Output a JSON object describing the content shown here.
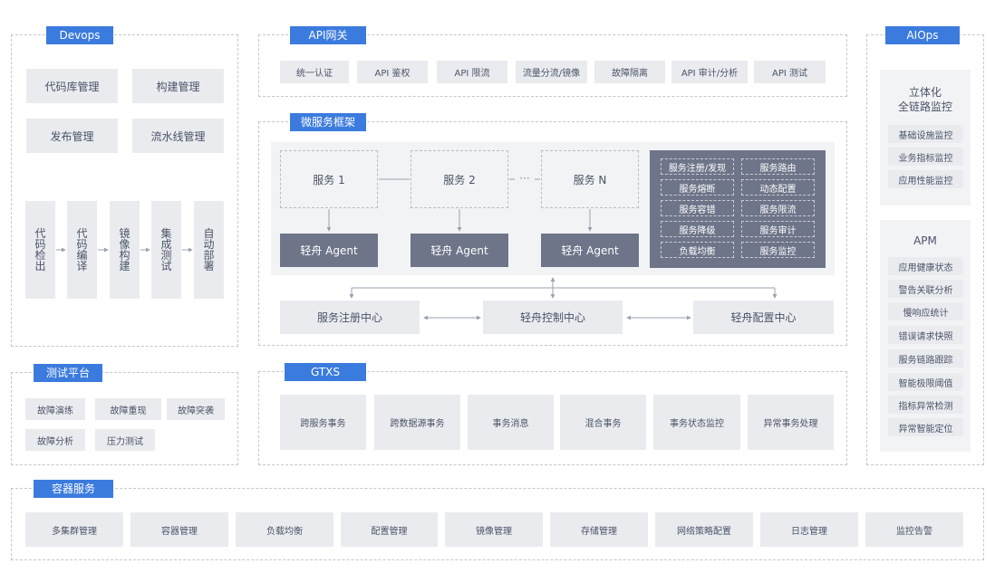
{
  "devops": {
    "tag": "Devops",
    "mgmt": [
      "代码库管理",
      "构建管理",
      "发布管理",
      "流水线管理"
    ],
    "pipeline": [
      "代码检出",
      "代码编译",
      "镜像构建",
      "集成测试",
      "自动部署"
    ]
  },
  "test_platform": {
    "tag": "测试平台",
    "items": [
      "故障演练",
      "故障重现",
      "故障突袭",
      "故障分析",
      "压力测试"
    ]
  },
  "api_gateway": {
    "tag": "API网关",
    "items": [
      "统一认证",
      "API 鉴权",
      "API 限流",
      "流量分流/镜像",
      "故障隔离",
      "API 审计/分析",
      "API 测试"
    ]
  },
  "microservice": {
    "tag": "微服务框架",
    "services": [
      "服务 1",
      "服务 2",
      "服务 N"
    ],
    "ellipsis": "···",
    "agents": [
      "轻舟 Agent",
      "轻舟 Agent",
      "轻舟 Agent"
    ],
    "features": [
      "服务注册/发现",
      "服务路由",
      "服务熔断",
      "动态配置",
      "服务容错",
      "服务限流",
      "服务降级",
      "服务审计",
      "负载均衡",
      "服务监控"
    ],
    "centers": [
      "服务注册中心",
      "轻舟控制中心",
      "轻舟配置中心"
    ]
  },
  "gtxs": {
    "tag": "GTXS",
    "items": [
      "跨服务事务",
      "跨数据源事务",
      "事务消息",
      "混合事务",
      "事务状态监控",
      "异常事务处理"
    ]
  },
  "aiops": {
    "tag": "AIOps",
    "monitor_title": "立体化\n全链路监控",
    "monitor_title_l1": "立体化",
    "monitor_title_l2": "全链路监控",
    "monitor_items": [
      "基础设施监控",
      "业务指标监控",
      "应用性能监控"
    ],
    "apm_title": "APM",
    "apm_items": [
      "应用健康状态",
      "警告关联分析",
      "慢响应统计",
      "错误请求快照",
      "服务链路跟踪",
      "智能极限阈值",
      "指标异常检测",
      "异常智能定位"
    ]
  },
  "container": {
    "tag": "容器服务",
    "items": [
      "多集群管理",
      "容器管理",
      "负载均衡",
      "配置管理",
      "镜像管理",
      "存储管理",
      "网络策略配置",
      "日志管理",
      "监控告警"
    ]
  },
  "colors": {
    "accent": "#3b7bde",
    "box": "#e9ebef",
    "agent": "#6e7589",
    "dark_panel": "#6e7589"
  }
}
